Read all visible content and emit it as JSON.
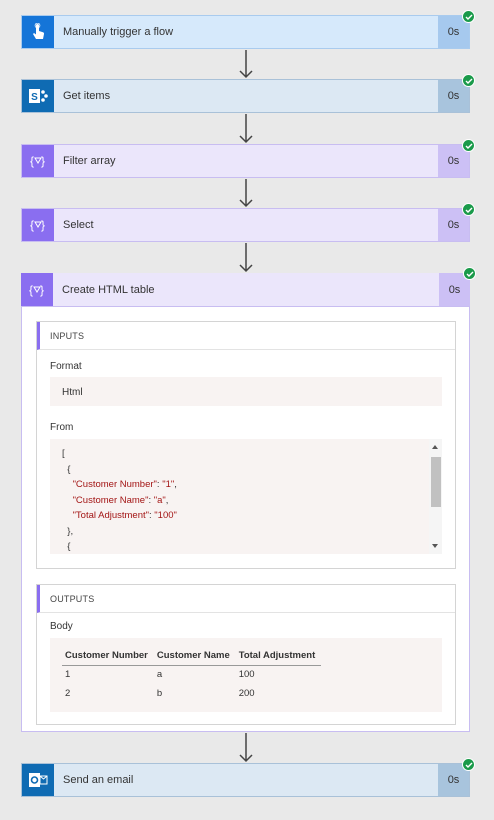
{
  "steps": [
    {
      "title": "Manually trigger a flow",
      "duration": "0s",
      "icon": "hand-touch-icon"
    },
    {
      "title": "Get items",
      "duration": "0s",
      "icon": "sharepoint-icon"
    },
    {
      "title": "Filter array",
      "duration": "0s",
      "icon": "data-operation-icon"
    },
    {
      "title": "Select",
      "duration": "0s",
      "icon": "data-operation-icon"
    },
    {
      "title": "Create HTML table",
      "duration": "0s",
      "icon": "data-operation-icon"
    },
    {
      "title": "Send an email",
      "duration": "0s",
      "icon": "outlook-icon"
    }
  ],
  "inputs": {
    "header": "INPUTS",
    "format_label": "Format",
    "format_value": "Html",
    "from_label": "From",
    "from_lines": {
      "l1": "[",
      "l2": "{",
      "l3_key": "\"Customer Number\"",
      "l3_val": "\"1\"",
      "l4_key": "\"Customer Name\"",
      "l4_val": "\"a\"",
      "l5_key": "\"Total Adjustment\"",
      "l5_val": "\"100\"",
      "l6": "},",
      "l7": "{"
    }
  },
  "outputs": {
    "header": "OUTPUTS",
    "body_label": "Body",
    "table": {
      "columns": [
        "Customer Number",
        "Customer Name",
        "Total Adjustment"
      ],
      "rows": [
        [
          "1",
          "a",
          "100"
        ],
        [
          "2",
          "b",
          "200"
        ]
      ]
    }
  },
  "colors": {
    "trigger": "#1575d8",
    "sharepoint": "#0f6bb3",
    "data_operation": "#8a6ef0",
    "outlook": "#0f6bb3",
    "success": "#1a9a4a"
  }
}
